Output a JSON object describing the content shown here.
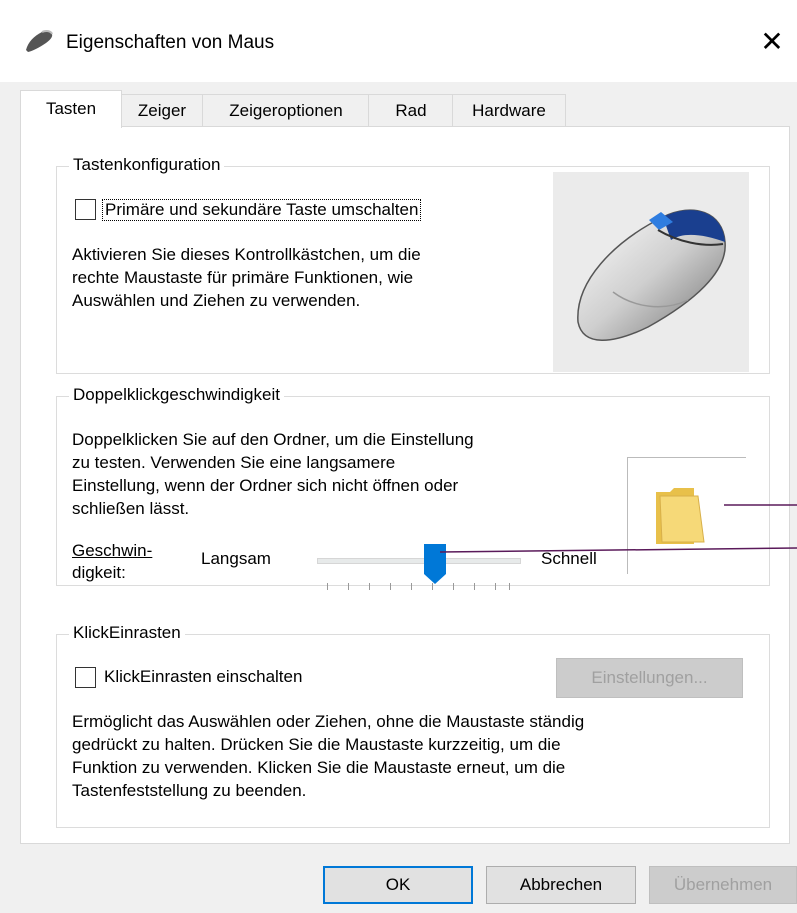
{
  "window": {
    "title": "Eigenschaften von Maus",
    "close_glyph": "✕"
  },
  "tabs": [
    {
      "label": "Tasten",
      "active": true
    },
    {
      "label": "Zeiger"
    },
    {
      "label": "Zeigeroptionen"
    },
    {
      "label": "Rad"
    },
    {
      "label": "Hardware"
    }
  ],
  "tastenkonfiguration": {
    "title": "Tastenkonfiguration",
    "checkbox_label": "Primäre und sekundäre Taste umschalten",
    "checked": false,
    "desc_lines": [
      "Aktivieren Sie dieses Kontrollkästchen, um die",
      "rechte Maustaste für primäre Funktionen, wie",
      "Auswählen und Ziehen zu verwenden."
    ]
  },
  "doppelklick": {
    "title": "Doppelklickgeschwindigkeit",
    "desc_lines": [
      "Doppelklicken Sie auf den Ordner, um die Einstellung",
      "zu testen. Verwenden Sie eine langsamere",
      "Einstellung, wenn der Ordner sich nicht öffnen oder",
      "schließen lässt."
    ],
    "speed_label_line1": "Geschwin-",
    "speed_label_line2": "digkeit:",
    "slow_label": "Langsam",
    "fast_label": "Schnell",
    "slider_value_fraction": 0.6
  },
  "klickeinrasten": {
    "title": "KlickEinrasten",
    "checkbox_label": "KlickEinrasten einschalten",
    "checked": false,
    "settings_button": "Einstellungen...",
    "desc_lines": [
      "Ermöglicht das Auswählen oder Ziehen, ohne die Maustaste ständig",
      "gedrückt zu halten. Drücken Sie die Maustaste kurzzeitig, um die",
      "Funktion zu verwenden. Klicken Sie die Maustaste erneut, um die",
      "Tastenfeststellung zu beenden."
    ]
  },
  "footer": {
    "ok": "OK",
    "cancel": "Abbrechen",
    "apply": "Übernehmen"
  },
  "colors": {
    "accent": "#0078d7",
    "tab_border": "#d9d9d9",
    "window_bg": "#f0f0f0"
  }
}
